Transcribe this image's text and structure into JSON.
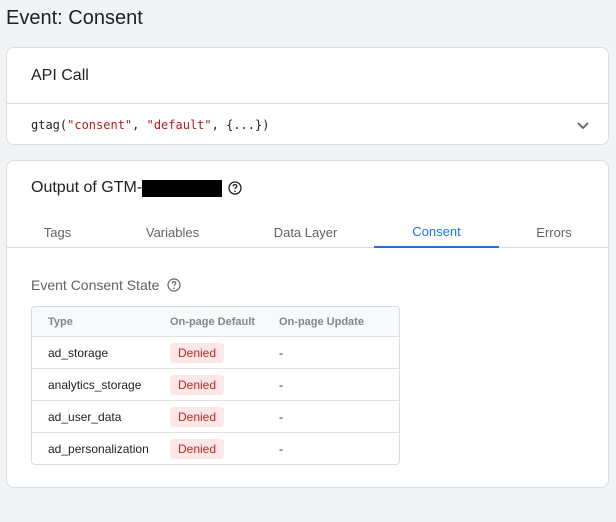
{
  "page": {
    "title": "Event: Consent"
  },
  "api_card": {
    "title": "API Call",
    "code": {
      "fn": "gtag(",
      "arg1": "\"consent\"",
      "sep1": ", ",
      "arg2": "\"default\"",
      "rest": ", {...})"
    },
    "expand_icon": "chevron-down-icon"
  },
  "output_card": {
    "title_prefix": "Output of GTM-",
    "help_icon": "question-circle-icon",
    "tabs": [
      {
        "label": "Tags",
        "active": false
      },
      {
        "label": "Variables",
        "active": false
      },
      {
        "label": "Data Layer",
        "active": false
      },
      {
        "label": "Consent",
        "active": true
      },
      {
        "label": "Errors",
        "active": false
      }
    ],
    "section_title": "Event Consent State",
    "table": {
      "headers": [
        "Type",
        "On-page Default",
        "On-page Update"
      ],
      "rows": [
        {
          "type": "ad_storage",
          "default": "Denied",
          "update": "-"
        },
        {
          "type": "analytics_storage",
          "default": "Denied",
          "update": "-"
        },
        {
          "type": "ad_user_data",
          "default": "Denied",
          "update": "-"
        },
        {
          "type": "ad_personalization",
          "default": "Denied",
          "update": "-"
        }
      ]
    }
  },
  "colors": {
    "accent": "#1a73e8",
    "denied_bg": "#fce8e6",
    "denied_text": "#c5221f",
    "string_literal": "#b71c1c"
  }
}
